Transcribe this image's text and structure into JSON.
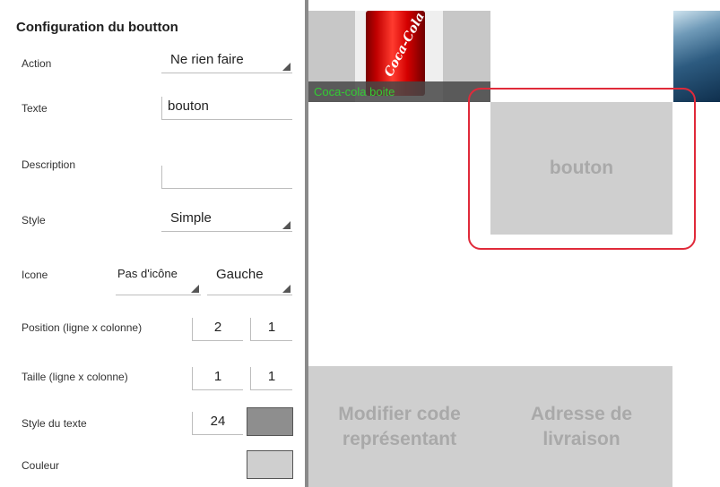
{
  "panel": {
    "title": "Configuration du boutton",
    "action": {
      "label": "Action",
      "value": "Ne rien faire"
    },
    "texte": {
      "label": "Texte",
      "value": "bouton"
    },
    "description": {
      "label": "Description",
      "value": ""
    },
    "style": {
      "label": "Style",
      "value": "Simple"
    },
    "icone": {
      "label": "Icone",
      "icon_value": "Pas d'icône",
      "position_value": "Gauche"
    },
    "position": {
      "label": "Position (ligne x colonne)",
      "row": "2",
      "col": "1"
    },
    "taille": {
      "label": "Taille (ligne x colonne)",
      "row": "1",
      "col": "1"
    },
    "style_texte": {
      "label": "Style du texte",
      "size": "24",
      "color": "#8e8e8e"
    },
    "couleur": {
      "label": "Couleur",
      "color": "#cfcfcf"
    }
  },
  "canvas": {
    "product_caption": "Coca-cola boite",
    "can_text": "Coca-Cola",
    "selected_button": "bouton",
    "button_modifier": "Modifier code représentant",
    "button_adresse": "Adresse de livraison"
  },
  "colors": {
    "selection": "#e02a3a",
    "caption_text": "#33cc33",
    "tile_bg": "#cfcfcf",
    "tile_text": "#a9a9a9"
  }
}
